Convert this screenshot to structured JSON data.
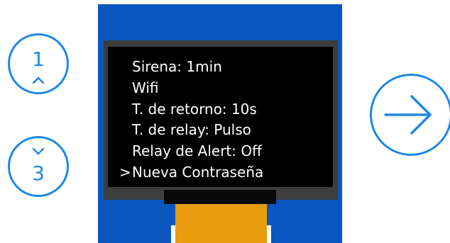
{
  "buttons": {
    "up": {
      "label": "1",
      "icon": "chevron-up-icon"
    },
    "down": {
      "label": "3",
      "icon": "chevron-down-icon"
    },
    "enter": {
      "icon": "arrow-right-icon"
    }
  },
  "screen": {
    "selection_marker": ">",
    "selected_index": 5,
    "items": [
      {
        "label": "Sirena: 1min"
      },
      {
        "label": "Wifi"
      },
      {
        "label": "T. de retorno: 10s"
      },
      {
        "label": "T. de relay: Pulso"
      },
      {
        "label": "Relay de Alert: Off"
      },
      {
        "label": "Nueva Contraseña"
      }
    ]
  },
  "colors": {
    "accent": "#1e88e5",
    "device_body": "#0b56bf",
    "bezel": "#3d3d3d",
    "screen": "#000000",
    "connector": "#e89c0e"
  }
}
